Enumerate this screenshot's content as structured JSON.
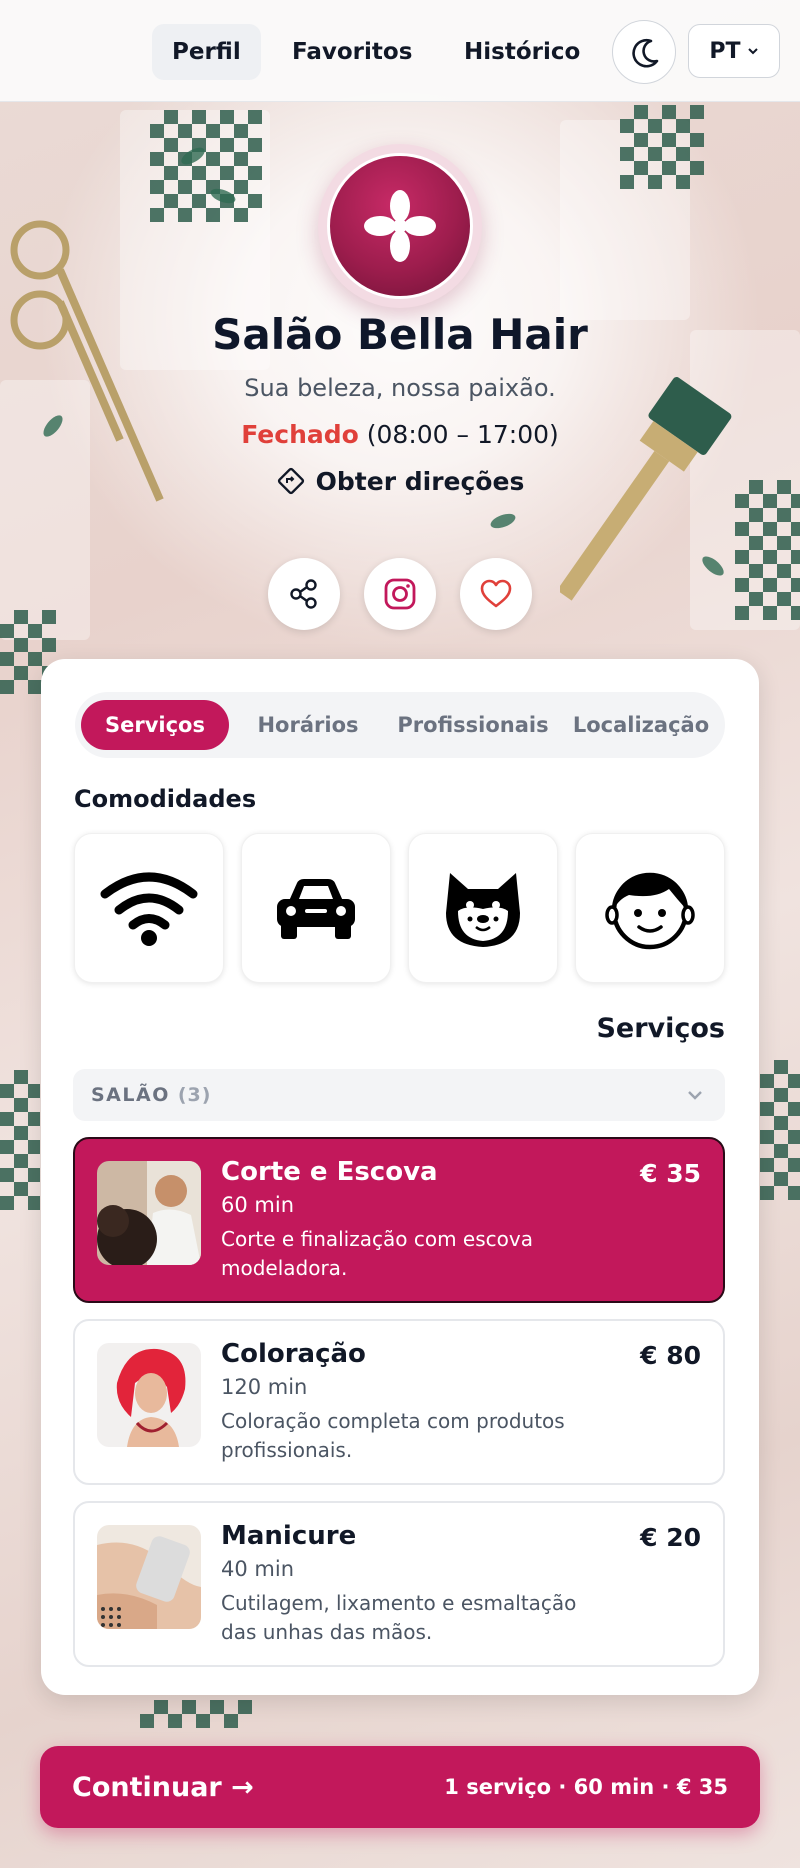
{
  "nav": {
    "tabs": [
      {
        "label": "Perfil",
        "active": true
      },
      {
        "label": "Favoritos",
        "active": false
      },
      {
        "label": "Histórico",
        "active": false
      }
    ],
    "theme_icon": "moon-icon",
    "language": "PT"
  },
  "hero": {
    "name": "Salão Bella Hair",
    "tagline": "Sua beleza, nossa paixão.",
    "status": "Fechado",
    "hours": "(08:00 – 17:00)",
    "directions": "Obter direções",
    "actions": [
      "share-icon",
      "instagram-icon",
      "heart-icon"
    ]
  },
  "segments": [
    {
      "label": "Serviços",
      "active": true
    },
    {
      "label": "Horários",
      "active": false
    },
    {
      "label": "Profissionais",
      "active": false
    },
    {
      "label": "Localização",
      "active": false
    }
  ],
  "amenities": {
    "title": "Comodidades",
    "items": [
      "wifi-icon",
      "car-icon",
      "dog-icon",
      "child-icon"
    ]
  },
  "services": {
    "title": "Serviços",
    "group": {
      "label": "SALÃO",
      "count": "(3)"
    },
    "items": [
      {
        "name": "Corte e Escova",
        "duration": "60 min",
        "description": "Corte e finalização com escova modeladora.",
        "price": "€ 35",
        "selected": true
      },
      {
        "name": "Coloração",
        "duration": "120 min",
        "description": "Coloração completa com produtos profissionais.",
        "price": "€ 80",
        "selected": false
      },
      {
        "name": "Manicure",
        "duration": "40 min",
        "description": "Cutilagem, lixamento e esmaltação das unhas das mãos.",
        "price": "€ 20",
        "selected": false
      }
    ]
  },
  "footer": {
    "continue_label": "Continuar →",
    "summary": "1 serviço · 60 min · € 35"
  },
  "colors": {
    "accent": "#c2185b",
    "closed": "#e0403a"
  }
}
